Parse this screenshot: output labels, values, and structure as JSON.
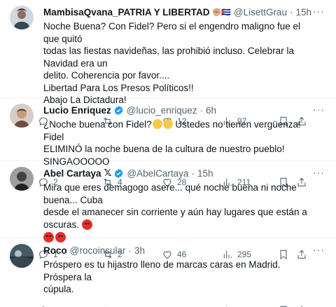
{
  "colors": {
    "verified": "#1d9bf0",
    "text": "#0f1419",
    "muted": "#536471"
  },
  "tweets": [
    {
      "name": "MambisaQvana_PATRIA Y LIBERTAD",
      "name_emoji": "✊🏼🇨🇺",
      "handle": "@LisettGrau",
      "time": "15h",
      "lines": [
        "Noche Buena? Con Fidel? Pero si el engendro maligno fue el que quitó",
        "todas las fiestas navideñas, las prohibió incluso. Celebrar la Navidad era un",
        "delito. Coherencia por favor....",
        "Libertad Para Los Presos Políticos!!",
        "Abajo La Dictadura!"
      ],
      "replies": "",
      "retweets": "",
      "likes": "12",
      "views": "97"
    },
    {
      "name": "Lucio Enriquez",
      "handle": "@lucio_enriquez",
      "time": "6h",
      "line1_prefix": "¿Noche buena con Fidel?",
      "line1_suffix": " Ustedes no tienen vergüenza! Fidel",
      "line2": "ELIMINÓ la noche buena de la cultura de nuestro pueblo! SINGAOOOOO",
      "replies": "2",
      "retweets": "4",
      "likes": "28",
      "views": "211"
    },
    {
      "name": "Abel Cartaya",
      "x_mark": "𝕏",
      "handle": "@AbelCartaya",
      "time": "15h",
      "line1": "Mira que eres demagogo asere... qué noche buena ni noche buena... Cuba",
      "line2": "desde el amanecer sin corriente y aún hay lugares que están a oscuras.",
      "replies": "1",
      "retweets": "2",
      "likes": "46",
      "views": "295"
    },
    {
      "name": "Roco",
      "handle": "@rocoinsular",
      "time": "3h",
      "lines": [
        "Próspero es tu hijastro lleno de marcas caras en Madrid. Próspera la",
        "cúpula."
      ],
      "replies": "",
      "retweets": "",
      "likes": "",
      "views": ""
    }
  ],
  "more_glyph": "···",
  "dot_glyph": "·"
}
